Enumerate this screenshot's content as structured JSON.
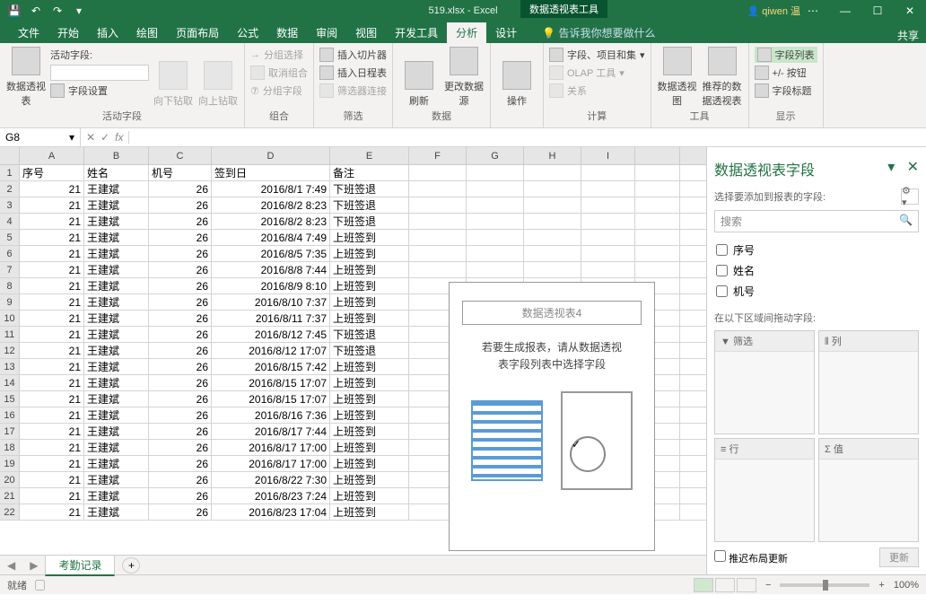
{
  "titlebar": {
    "filename": "519.xlsx - Excel",
    "tool_tab": "数据透视表工具",
    "user": "qiwen 温"
  },
  "tabs": {
    "items": [
      "文件",
      "开始",
      "插入",
      "绘图",
      "页面布局",
      "公式",
      "数据",
      "审阅",
      "视图",
      "开发工具",
      "分析",
      "设计"
    ],
    "active": 10,
    "tell_me": "告诉我你想要做什么",
    "share": "共享"
  },
  "ribbon": {
    "g0": {
      "btn": "数据透视表",
      "r1": "活动字段:",
      "r2": "字段设置",
      "drill_down": "向下钻取",
      "drill_up": "向上钻取",
      "label": "活动字段"
    },
    "g1": {
      "r1": "分组选择",
      "r2": "取消组合",
      "r3": "分组字段",
      "label": "组合"
    },
    "g2": {
      "r1": "插入切片器",
      "r2": "插入日程表",
      "r3": "筛选器连接",
      "label": "筛选"
    },
    "g3": {
      "b1": "刷新",
      "b2": "更改数据源",
      "label": "数据"
    },
    "g4": {
      "b1": "操作",
      "label": ""
    },
    "g5": {
      "r1": "字段、项目和集",
      "r2": "OLAP 工具",
      "r3": "关系",
      "label": "计算"
    },
    "g6": {
      "b1": "数据透视图",
      "b2": "推荐的数据透视表",
      "label": "工具"
    },
    "g7": {
      "r1": "字段列表",
      "r2": "+/- 按钮",
      "r3": "字段标题",
      "label": "显示"
    }
  },
  "formula": {
    "cell_ref": "G8",
    "fx": "fx"
  },
  "columns": [
    "A",
    "B",
    "C",
    "D",
    "E",
    "F",
    "G",
    "H",
    "I",
    ""
  ],
  "headers": {
    "A": "序号",
    "B": "姓名",
    "C": "机号",
    "D": "签到日",
    "E": "备注"
  },
  "data_rows": [
    {
      "n": 2,
      "A": 21,
      "B": "王建斌",
      "C": 26,
      "D": "2016/8/1 7:49",
      "E": "下班签退"
    },
    {
      "n": 3,
      "A": 21,
      "B": "王建斌",
      "C": 26,
      "D": "2016/8/2 8:23",
      "E": "下班签退"
    },
    {
      "n": 4,
      "A": 21,
      "B": "王建斌",
      "C": 26,
      "D": "2016/8/2 8:23",
      "E": "下班签退"
    },
    {
      "n": 5,
      "A": 21,
      "B": "王建斌",
      "C": 26,
      "D": "2016/8/4 7:49",
      "E": "上班签到"
    },
    {
      "n": 6,
      "A": 21,
      "B": "王建斌",
      "C": 26,
      "D": "2016/8/5 7:35",
      "E": "上班签到"
    },
    {
      "n": 7,
      "A": 21,
      "B": "王建斌",
      "C": 26,
      "D": "2016/8/8 7:44",
      "E": "上班签到"
    },
    {
      "n": 8,
      "A": 21,
      "B": "王建斌",
      "C": 26,
      "D": "2016/8/9 8:10",
      "E": "上班签到"
    },
    {
      "n": 9,
      "A": 21,
      "B": "王建斌",
      "C": 26,
      "D": "2016/8/10 7:37",
      "E": "上班签到"
    },
    {
      "n": 10,
      "A": 21,
      "B": "王建斌",
      "C": 26,
      "D": "2016/8/11 7:37",
      "E": "上班签到"
    },
    {
      "n": 11,
      "A": 21,
      "B": "王建斌",
      "C": 26,
      "D": "2016/8/12 7:45",
      "E": "下班签退"
    },
    {
      "n": 12,
      "A": 21,
      "B": "王建斌",
      "C": 26,
      "D": "2016/8/12 17:07",
      "E": "下班签退"
    },
    {
      "n": 13,
      "A": 21,
      "B": "王建斌",
      "C": 26,
      "D": "2016/8/15 7:42",
      "E": "上班签到"
    },
    {
      "n": 14,
      "A": 21,
      "B": "王建斌",
      "C": 26,
      "D": "2016/8/15 17:07",
      "E": "上班签到"
    },
    {
      "n": 15,
      "A": 21,
      "B": "王建斌",
      "C": 26,
      "D": "2016/8/15 17:07",
      "E": "上班签到"
    },
    {
      "n": 16,
      "A": 21,
      "B": "王建斌",
      "C": 26,
      "D": "2016/8/16 7:36",
      "E": "上班签到"
    },
    {
      "n": 17,
      "A": 21,
      "B": "王建斌",
      "C": 26,
      "D": "2016/8/17 7:44",
      "E": "上班签到"
    },
    {
      "n": 18,
      "A": 21,
      "B": "王建斌",
      "C": 26,
      "D": "2016/8/17 17:00",
      "E": "上班签到"
    },
    {
      "n": 19,
      "A": 21,
      "B": "王建斌",
      "C": 26,
      "D": "2016/8/17 17:00",
      "E": "上班签到"
    },
    {
      "n": 20,
      "A": 21,
      "B": "王建斌",
      "C": 26,
      "D": "2016/8/22 7:30",
      "E": "上班签到"
    },
    {
      "n": 21,
      "A": 21,
      "B": "王建斌",
      "C": 26,
      "D": "2016/8/23 7:24",
      "E": "上班签到"
    },
    {
      "n": 22,
      "A": 21,
      "B": "王建斌",
      "C": 26,
      "D": "2016/8/23 17:04",
      "E": "上班签到"
    }
  ],
  "pivot_overlay": {
    "title": "数据透视表4",
    "msg1": "若要生成报表，请从数据透视",
    "msg2": "表字段列表中选择字段"
  },
  "sheet_tabs": {
    "active": "考勤记录",
    "add": "+"
  },
  "panel": {
    "title": "数据透视表字段",
    "sub": "选择要添加到报表的字段:",
    "search": "搜索",
    "fields": [
      "序号",
      "姓名",
      "机号"
    ],
    "areas_label": "在以下区域间拖动字段:",
    "areas": {
      "filter": "筛选",
      "columns": "列",
      "rows": "行",
      "values": "值"
    },
    "defer": "推迟布局更新",
    "update": "更新"
  },
  "status": {
    "ready": "就绪",
    "zoom": "100%"
  }
}
